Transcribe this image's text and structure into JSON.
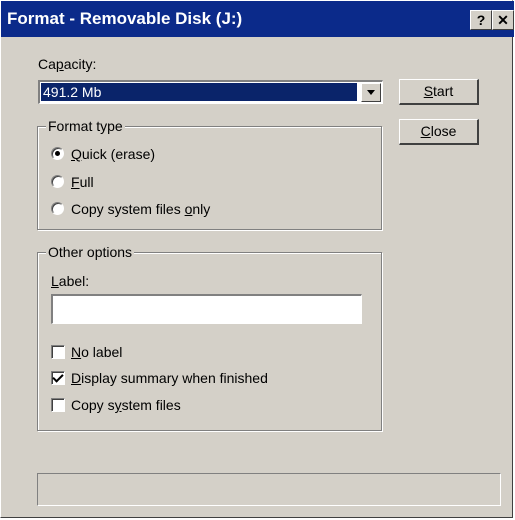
{
  "window": {
    "title": "Format - Removable Disk (J:)"
  },
  "titlebar": {
    "help_label": "?",
    "close_label": "✕"
  },
  "capacity": {
    "label": "Capacity:",
    "selected_value": "491.2 Mb"
  },
  "buttons": {
    "start_label": "Start",
    "close_label": "Close"
  },
  "format_type": {
    "title": "Format type",
    "options": [
      {
        "label": "Quick (erase)",
        "selected": true
      },
      {
        "label": "Full",
        "selected": false
      },
      {
        "label": "Copy system files only",
        "selected": false
      }
    ]
  },
  "other_options": {
    "title": "Other options",
    "label_field": {
      "label": "Label:",
      "value": ""
    },
    "checkboxes": [
      {
        "label": "No label",
        "checked": false
      },
      {
        "label": "Display summary when finished",
        "checked": true
      },
      {
        "label": "Copy system files",
        "checked": false
      }
    ]
  },
  "status": {
    "text": ""
  }
}
